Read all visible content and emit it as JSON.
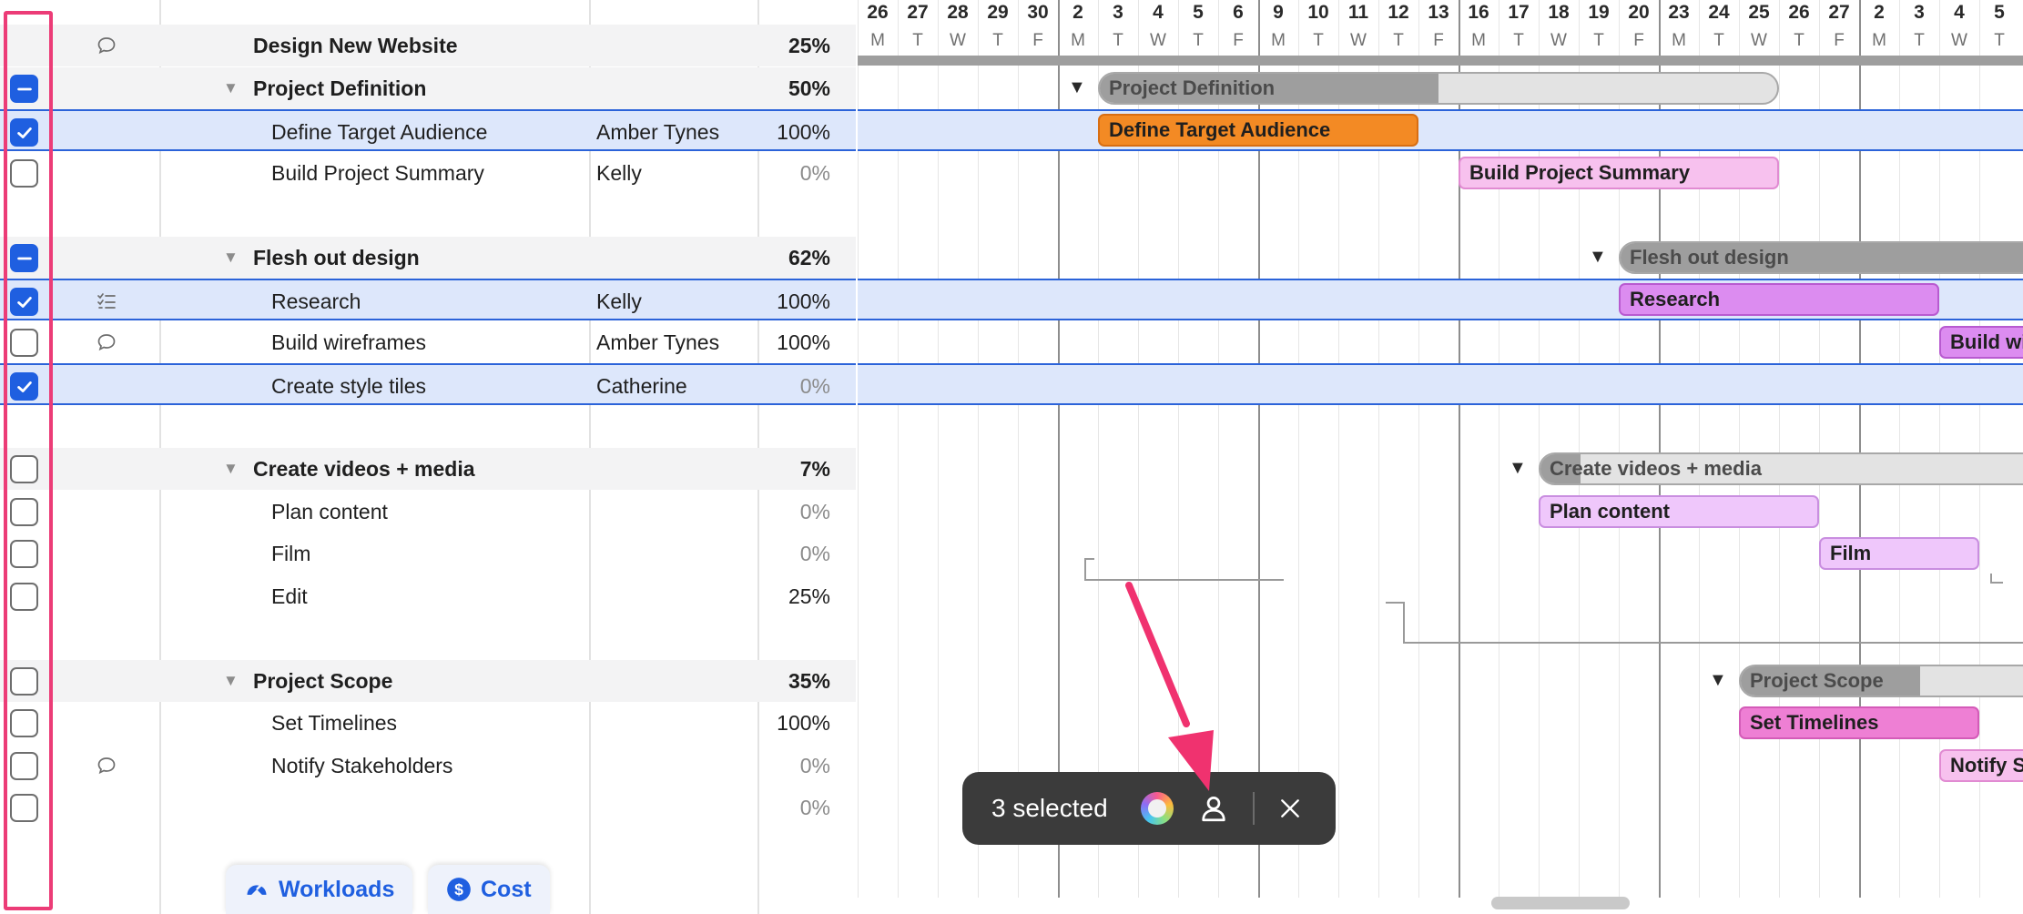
{
  "grid": {
    "rows": [
      {
        "type": "project",
        "name": "Design New Website",
        "assignee": "",
        "percent": "25%",
        "checkbox": "none",
        "icon": "comment-icon"
      },
      {
        "type": "group",
        "name": "Project Definition",
        "assignee": "",
        "percent": "50%",
        "checkbox": "mixed",
        "icon": ""
      },
      {
        "type": "task",
        "name": "Define Target Audience",
        "assignee": "Amber Tynes",
        "percent": "100%",
        "checkbox": "checked",
        "icon": "",
        "selected": true
      },
      {
        "type": "task",
        "name": "Build Project Summary",
        "assignee": "Kelly",
        "percent": "0%",
        "checkbox": "unchecked",
        "icon": ""
      },
      {
        "type": "spacer"
      },
      {
        "type": "group",
        "name": "Flesh out design",
        "assignee": "",
        "percent": "62%",
        "checkbox": "mixed",
        "icon": ""
      },
      {
        "type": "task",
        "name": "Research",
        "assignee": "Kelly",
        "percent": "100%",
        "checkbox": "checked",
        "icon": "checklist-icon",
        "selected": true
      },
      {
        "type": "task",
        "name": "Build wireframes",
        "assignee": "Amber Tynes",
        "percent": "100%",
        "checkbox": "unchecked",
        "icon": "comment-icon"
      },
      {
        "type": "task",
        "name": "Create style tiles",
        "assignee": "Catherine",
        "percent": "0%",
        "checkbox": "checked",
        "icon": "",
        "selected": true
      },
      {
        "type": "spacer"
      },
      {
        "type": "group",
        "name": "Create videos + media",
        "assignee": "",
        "percent": "7%",
        "checkbox": "unchecked",
        "icon": ""
      },
      {
        "type": "task",
        "name": "Plan content",
        "assignee": "",
        "percent": "0%",
        "checkbox": "unchecked",
        "icon": ""
      },
      {
        "type": "task",
        "name": "Film",
        "assignee": "",
        "percent": "0%",
        "checkbox": "unchecked",
        "icon": ""
      },
      {
        "type": "task",
        "name": "Edit",
        "assignee": "",
        "percent": "25%",
        "checkbox": "unchecked",
        "icon": ""
      },
      {
        "type": "spacer"
      },
      {
        "type": "group",
        "name": "Project Scope",
        "assignee": "",
        "percent": "35%",
        "checkbox": "unchecked",
        "icon": ""
      },
      {
        "type": "task",
        "name": "Set Timelines",
        "assignee": "",
        "percent": "100%",
        "checkbox": "unchecked",
        "icon": ""
      },
      {
        "type": "task",
        "name": "Notify Stakeholders",
        "assignee": "",
        "percent": "0%",
        "checkbox": "unchecked",
        "icon": "comment-icon"
      },
      {
        "type": "task",
        "name": "",
        "assignee": "",
        "percent": "0%",
        "checkbox": "unchecked",
        "icon": ""
      }
    ]
  },
  "footer_buttons": {
    "workloads_label": "Workloads",
    "workloads_icon": "gauge-icon",
    "cost_label": "Cost",
    "cost_icon": "dollar-icon"
  },
  "timeline": {
    "days": [
      {
        "num": "26",
        "letter": "M"
      },
      {
        "num": "27",
        "letter": "T"
      },
      {
        "num": "28",
        "letter": "W"
      },
      {
        "num": "29",
        "letter": "T"
      },
      {
        "num": "30",
        "letter": "F"
      },
      {
        "num": "2",
        "letter": "M"
      },
      {
        "num": "3",
        "letter": "T"
      },
      {
        "num": "4",
        "letter": "W"
      },
      {
        "num": "5",
        "letter": "T"
      },
      {
        "num": "6",
        "letter": "F"
      },
      {
        "num": "9",
        "letter": "M"
      },
      {
        "num": "10",
        "letter": "T"
      },
      {
        "num": "11",
        "letter": "W"
      },
      {
        "num": "12",
        "letter": "T"
      },
      {
        "num": "13",
        "letter": "F"
      },
      {
        "num": "16",
        "letter": "M"
      },
      {
        "num": "17",
        "letter": "T"
      },
      {
        "num": "18",
        "letter": "W"
      },
      {
        "num": "19",
        "letter": "T"
      },
      {
        "num": "20",
        "letter": "F"
      },
      {
        "num": "23",
        "letter": "M"
      },
      {
        "num": "24",
        "letter": "T"
      },
      {
        "num": "25",
        "letter": "W"
      },
      {
        "num": "26",
        "letter": "T"
      },
      {
        "num": "27",
        "letter": "F"
      },
      {
        "num": "2",
        "letter": "M"
      },
      {
        "num": "3",
        "letter": "T"
      },
      {
        "num": "4",
        "letter": "W"
      },
      {
        "num": "5",
        "letter": "T"
      }
    ],
    "bars": [
      {
        "row": 1,
        "label": "Project Definition",
        "kind": "group",
        "start": 6,
        "end": 23,
        "progress": 0.5
      },
      {
        "row": 2,
        "label": "Define Target Audience",
        "kind": "task",
        "start": 6,
        "end": 14,
        "color": "#f38a24",
        "border": "#d86e12"
      },
      {
        "row": 3,
        "label": "Build Project Summary",
        "kind": "task",
        "start": 15,
        "end": 23,
        "color": "#f7c1ee",
        "border": "#e18bd2"
      },
      {
        "row": 5,
        "label": "Flesh out design",
        "kind": "group",
        "start": 19,
        "end": 30,
        "progress": 1.0
      },
      {
        "row": 6,
        "label": "Research",
        "kind": "task",
        "start": 19,
        "end": 27,
        "color": "#dc8cf0",
        "border": "#b85ad0"
      },
      {
        "row": 7,
        "label": "Build wireframes",
        "kind": "task",
        "start": 27,
        "end": 30,
        "color": "#dc8cf0",
        "border": "#b85ad0"
      },
      {
        "row": 10,
        "label": "Create videos + media",
        "kind": "group",
        "start": 17,
        "end": 30,
        "progress": 0.08
      },
      {
        "row": 11,
        "label": "Plan content",
        "kind": "task",
        "start": 17,
        "end": 24,
        "color": "#efc7fb",
        "border": "#c98ee0"
      },
      {
        "row": 12,
        "label": "Film",
        "kind": "task",
        "start": 24,
        "end": 28,
        "color": "#efc7fb",
        "border": "#c98ee0"
      },
      {
        "row": 15,
        "label": "Project Scope",
        "kind": "group",
        "start": 22,
        "end": 30,
        "progress": 0.6
      },
      {
        "row": 16,
        "label": "Set Timelines",
        "kind": "task",
        "start": 22,
        "end": 28,
        "color": "#ee7fd4",
        "border": "#d45bb8"
      },
      {
        "row": 17,
        "label": "Notify Stakeholders",
        "kind": "task",
        "start": 27,
        "end": 30,
        "color": "#f7c1ee",
        "border": "#e18bd2"
      }
    ]
  },
  "selection_toolbar": {
    "count_label": "3 selected",
    "color_icon": "color-wheel-icon",
    "assign_icon": "person-icon",
    "close_icon": "close-icon"
  },
  "colors": {
    "accent_blue": "#1f5fe0",
    "selection_fill": "#dde7fb",
    "highlight_pink": "#ec3c77"
  }
}
